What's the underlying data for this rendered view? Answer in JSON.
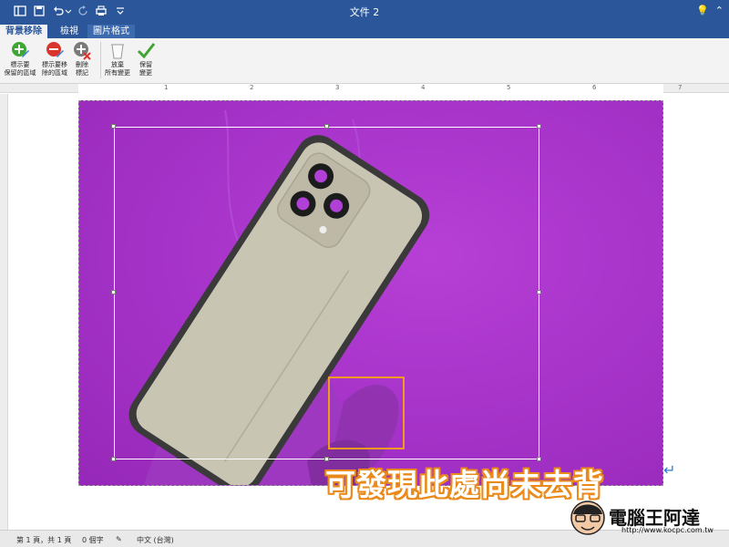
{
  "window": {
    "title": "文件 2"
  },
  "tabs": [
    {
      "label": "背景移除"
    },
    {
      "label": "檢視"
    },
    {
      "label": "圖片格式"
    }
  ],
  "ribbon": {
    "mark_keep": "標示要\n保留的區域",
    "mark_remove": "標示要移\n除的區域",
    "delete_mark": "刪除\n標記",
    "discard_changes": "放棄\n所有變更",
    "keep_changes": "保留\n變更"
  },
  "ruler": {
    "numbers": [
      "1",
      "2",
      "3",
      "4",
      "5",
      "6",
      "7"
    ]
  },
  "annotation": {
    "caption": "可發現此處尚未去背"
  },
  "status": {
    "page": "第 1 頁，共 1 頁",
    "words": "0 個字",
    "language": "中文 (台灣)"
  },
  "watermark": {
    "name": "電腦王阿達",
    "url": "http://www.kocpc.com.tw"
  },
  "colors": {
    "titlebar": "#2b579a",
    "background_removed": "#a532c8",
    "highlight": "#f29a1e"
  }
}
